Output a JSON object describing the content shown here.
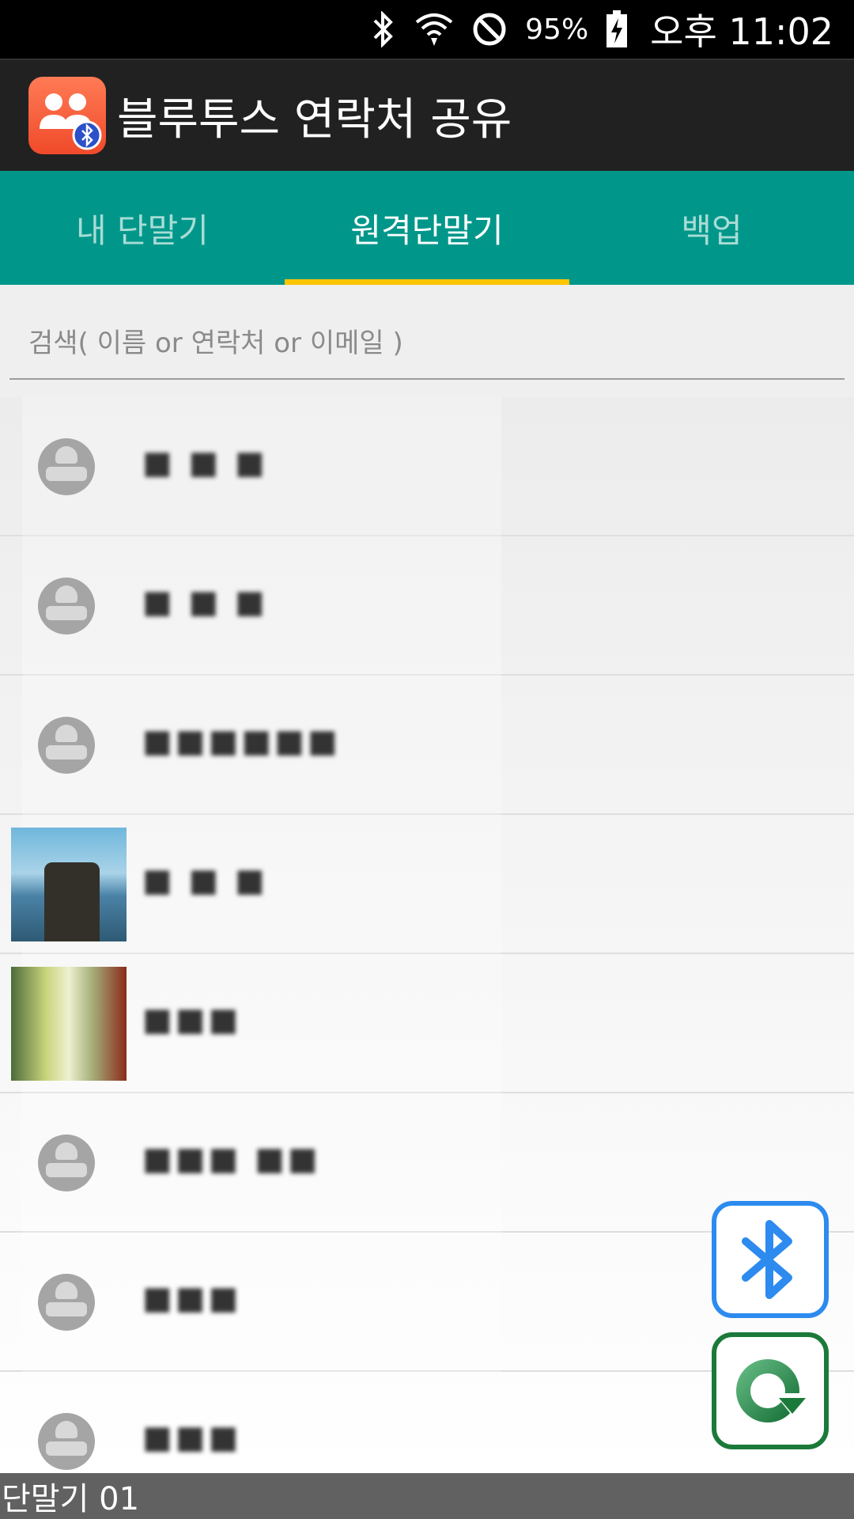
{
  "status_bar": {
    "battery_percent": "95%",
    "time": "오후 11:02",
    "icons": [
      "bluetooth-icon",
      "wifi-icon",
      "do-not-disturb-icon",
      "battery-charging-icon"
    ]
  },
  "app_bar": {
    "title": "블루투스 연락처 공유",
    "logo_icon": "contacts-bluetooth-logo"
  },
  "tabs": [
    {
      "label": "내 단말기",
      "active": false
    },
    {
      "label": "원격단말기",
      "active": true
    },
    {
      "label": "백업",
      "active": false
    }
  ],
  "search": {
    "placeholder": "검색( 이름 or 연락처 or 이메일 )",
    "value": ""
  },
  "contacts": [
    {
      "name": "■ ■ ■",
      "avatar": "default"
    },
    {
      "name": "■ ■ ■",
      "avatar": "default"
    },
    {
      "name": "■■■■■■",
      "avatar": "default"
    },
    {
      "name": "■ ■ ■",
      "avatar": "photo-sea"
    },
    {
      "name": "■■■",
      "avatar": "photo-street"
    },
    {
      "name": "■■■ ■■",
      "avatar": "default"
    },
    {
      "name": "■■■",
      "avatar": "default"
    },
    {
      "name": "■■■",
      "avatar": "default"
    }
  ],
  "fab": {
    "bluetooth_icon": "bluetooth-icon",
    "refresh_icon": "refresh-icon"
  },
  "bottom_status": {
    "text": "단말기 01"
  },
  "colors": {
    "tab_bar": "#00978a",
    "tab_indicator": "#ffc400",
    "app_bar": "#212121",
    "bluetooth_button": "#2d8bef",
    "refresh_button": "#1b7a3a"
  }
}
